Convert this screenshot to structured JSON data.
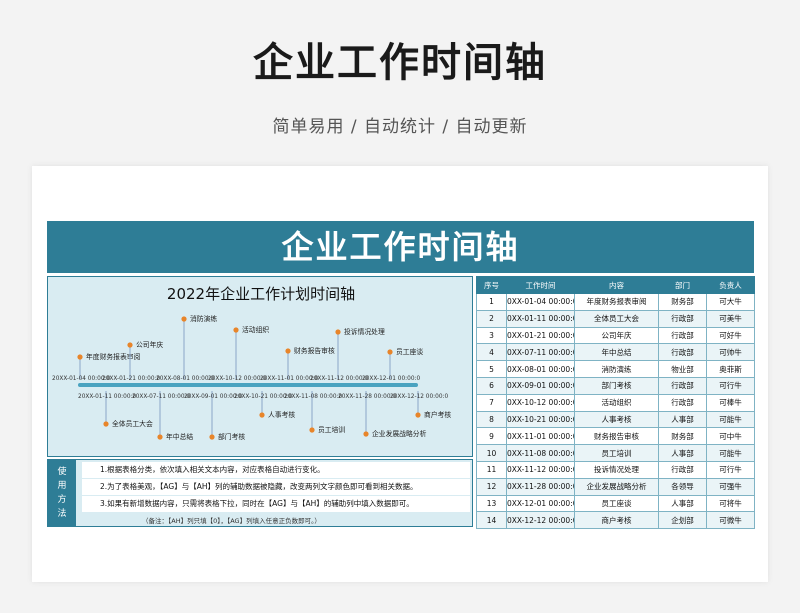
{
  "hero": {
    "title": "企业工作时间轴",
    "subtitle": "简单易用 / 自动统计 / 自动更新"
  },
  "sheet": {
    "banner": "企业工作时间轴",
    "timeline_title": "2022年企业工作计划时间轴",
    "usage_label": "使用方法",
    "usage_lines": [
      "1.根据表格分类，依次填入相关文本内容，对应表格自动进行变化。",
      "2.为了表格美观，【AG】与【AH】列的辅助数据被隐藏，改变两列文字颜色即可看到相关数据。",
      "3.如果有新增数据内容，只需将表格下拉，同时在【AG】与【AH】的辅助列中填入数据即可。"
    ],
    "usage_note": "（备注：【AH】列只填【0】，【AG】列填入任意正负数即可。）"
  },
  "table": {
    "headers": [
      "序号",
      "工作时间",
      "内容",
      "部门",
      "负责人"
    ],
    "rows": [
      [
        "1",
        "0XX-01-04 00:00:0",
        "年度财务报表审阅",
        "财务部",
        "可大牛"
      ],
      [
        "2",
        "0XX-01-11 00:00:0",
        "全体员工大会",
        "行政部",
        "可美牛"
      ],
      [
        "3",
        "0XX-01-21 00:00:0",
        "公司年庆",
        "行政部",
        "可好牛"
      ],
      [
        "4",
        "0XX-07-11 00:00:0",
        "年中总结",
        "行政部",
        "可帅牛"
      ],
      [
        "5",
        "0XX-08-01 00:00:0",
        "消防演练",
        "物业部",
        "奥菲斯"
      ],
      [
        "6",
        "0XX-09-01 00:00:0",
        "部门考核",
        "行政部",
        "可行牛"
      ],
      [
        "7",
        "0XX-10-12 00:00:0",
        "活动组织",
        "行政部",
        "可棒牛"
      ],
      [
        "8",
        "0XX-10-21 00:00:0",
        "人事考核",
        "人事部",
        "可能牛"
      ],
      [
        "9",
        "0XX-11-01 00:00:0",
        "财务报告审核",
        "财务部",
        "可中牛"
      ],
      [
        "10",
        "0XX-11-08 00:00:0",
        "员工培训",
        "人事部",
        "可能牛"
      ],
      [
        "11",
        "0XX-11-12 00:00:0",
        "投诉情况处理",
        "行政部",
        "可行牛"
      ],
      [
        "12",
        "0XX-11-28 00:00:0",
        "企业发展战略分析",
        "各领导",
        "可强牛"
      ],
      [
        "13",
        "0XX-12-01 00:00:0",
        "员工座谈",
        "人事部",
        "可将牛"
      ],
      [
        "14",
        "0XX-12-12 00:00:0",
        "商户考核",
        "企划部",
        "可微牛"
      ]
    ]
  },
  "timeline": {
    "accent": "#e8852a",
    "axis_color": "#4aa3c0",
    "top_dates": [
      "20XX-01-04 00:00:0",
      "20XX-01-21 00:00:0",
      "20XX-08-01 00:00:0",
      "20XX-10-12 00:00:0",
      "20XX-11-01 00:00:0",
      "20XX-11-12 00:00:0",
      "20XX-12-01 00:00:0"
    ],
    "bottom_dates": [
      "20XX-01-11 00:00:0",
      "20XX-07-11 00:00:0",
      "20XX-09-01 00:00:0",
      "20XX-10-21 00:00:0",
      "20XX-11-08 00:00:0",
      "20XX-11-28 00:00:0",
      "20XX-12-12 00:00:0"
    ],
    "events_above": [
      "年度财务报表审阅",
      "公司年庆",
      "消防演练",
      "活动组织",
      "财务报告审核",
      "投诉情况处理",
      "员工座谈"
    ],
    "events_below": [
      "全体员工大会",
      "年中总结",
      "部门考核",
      "人事考核",
      "员工培训",
      "企业发展战略分析",
      "商户考核"
    ]
  }
}
